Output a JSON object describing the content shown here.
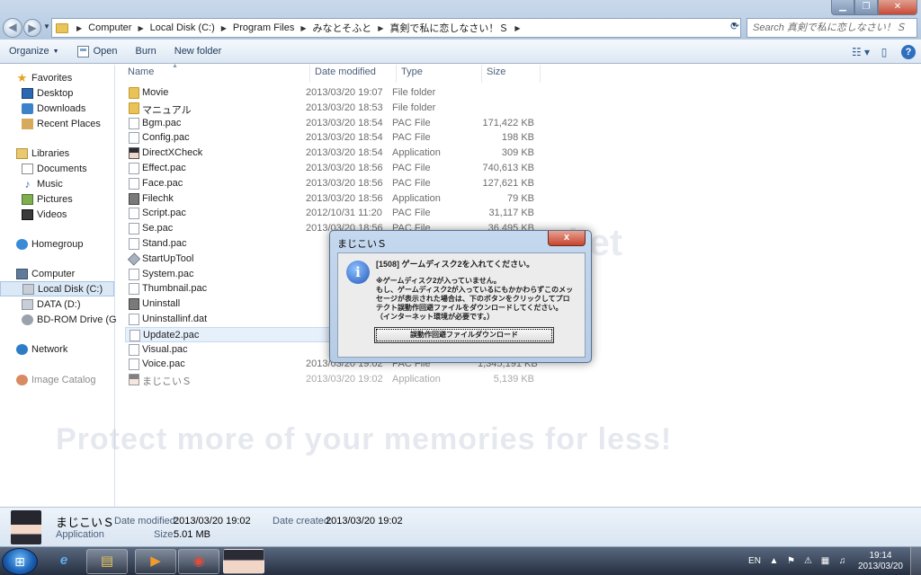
{
  "address_bar": {
    "crumbs": [
      "Computer",
      "Local Disk (C:)",
      "Program Files",
      "みなとそふと",
      "真剣で私に恋しなさい！Ｓ"
    ],
    "search_placeholder": "Search 真剣で私に恋しなさい！Ｓ"
  },
  "toolbar": {
    "organize": "Organize",
    "open": "Open",
    "burn": "Burn",
    "new_folder": "New folder"
  },
  "nav": {
    "favorites": "Favorites",
    "desktop": "Desktop",
    "downloads": "Downloads",
    "recent": "Recent Places",
    "libraries": "Libraries",
    "documents": "Documents",
    "music": "Music",
    "pictures": "Pictures",
    "videos": "Videos",
    "homegroup": "Homegroup",
    "computer": "Computer",
    "local_disk": "Local Disk (C:)",
    "data_d": "DATA (D:)",
    "bd_rom": "BD-ROM Drive (G:) M",
    "network": "Network",
    "image_catalog": "Image Catalog"
  },
  "columns": {
    "name": "Name",
    "date": "Date modified",
    "type": "Type",
    "size": "Size"
  },
  "files": [
    {
      "name": "Movie",
      "date": "2013/03/20 19:07",
      "type": "File folder",
      "size": "",
      "icon": "folder"
    },
    {
      "name": "マニュアル",
      "date": "2013/03/20 18:53",
      "type": "File folder",
      "size": "",
      "icon": "folder"
    },
    {
      "name": "Bgm.pac",
      "date": "2013/03/20 18:54",
      "type": "PAC File",
      "size": "171,422 KB",
      "icon": "file"
    },
    {
      "name": "Config.pac",
      "date": "2013/03/20 18:54",
      "type": "PAC File",
      "size": "198 KB",
      "icon": "file"
    },
    {
      "name": "DirectXCheck",
      "date": "2013/03/20 18:54",
      "type": "Application",
      "size": "309 KB",
      "icon": "avatar"
    },
    {
      "name": "Effect.pac",
      "date": "2013/03/20 18:56",
      "type": "PAC File",
      "size": "740,613 KB",
      "icon": "file"
    },
    {
      "name": "Face.pac",
      "date": "2013/03/20 18:56",
      "type": "PAC File",
      "size": "127,621 KB",
      "icon": "file"
    },
    {
      "name": "Filechk",
      "date": "2013/03/20 18:56",
      "type": "Application",
      "size": "79 KB",
      "icon": "app"
    },
    {
      "name": "Script.pac",
      "date": "2012/10/31 11:20",
      "type": "PAC File",
      "size": "31,117 KB",
      "icon": "file"
    },
    {
      "name": "Se.pac",
      "date": "2013/03/20 18:56",
      "type": "PAC File",
      "size": "36,495 KB",
      "icon": "file"
    },
    {
      "name": "Stand.pac",
      "date": "",
      "type": "",
      "size": "",
      "icon": "file"
    },
    {
      "name": "StartUpTool",
      "date": "",
      "type": "",
      "size": "",
      "icon": "tool"
    },
    {
      "name": "System.pac",
      "date": "",
      "type": "",
      "size": "",
      "icon": "file"
    },
    {
      "name": "Thumbnail.pac",
      "date": "",
      "type": "",
      "size": "",
      "icon": "file"
    },
    {
      "name": "Uninstall",
      "date": "",
      "type": "",
      "size": "",
      "icon": "app"
    },
    {
      "name": "Uninstallinf.dat",
      "date": "",
      "type": "",
      "size": "",
      "icon": "file"
    },
    {
      "name": "Update2.pac",
      "date": "",
      "type": "",
      "size": "",
      "icon": "file"
    },
    {
      "name": "Visual.pac",
      "date": "",
      "type": "",
      "size": "",
      "icon": "file"
    },
    {
      "name": "Voice.pac",
      "date": "2013/03/20 19:02",
      "type": "PAC File",
      "size": "1,345,191 KB",
      "icon": "file"
    },
    {
      "name": "まじこいＳ",
      "date": "2013/03/20 19:02",
      "type": "Application",
      "size": "5,139 KB",
      "icon": "avatar"
    }
  ],
  "dialog": {
    "title": "まじこいＳ",
    "close": "x",
    "heading": "[1508] ゲームディスク2を入れてください。",
    "message": [
      "※ゲームディスク2が入っていません。",
      "もし、ゲームディスク2が入っているにもかかわらずこのメッ",
      "セージが表示された場合は、下のボタンをクリックしてプロ",
      "テクト誤動作回避ファイルをダウンロードしてください。",
      "（インターネット環境が必要です。）"
    ],
    "button": "誤動作回避ファイルダウンロード"
  },
  "details": {
    "name": "まじこいＳ",
    "type": "Application",
    "modified_label": "Date modified:",
    "modified_value": "2013/03/20 19:02",
    "created_label": "Date created:",
    "created_value": "2013/03/20 19:02",
    "size_label": "Size:",
    "size_value": "5.01 MB"
  },
  "watermark": {
    "logo": "photobucket",
    "text": "Protect more of your memories for less!"
  },
  "taskbar": {
    "lang": "EN",
    "time": "19:14",
    "date": "2013/03/20"
  },
  "colors": {
    "accent": "#2f6fc0",
    "selection": "#dbe8f6"
  }
}
